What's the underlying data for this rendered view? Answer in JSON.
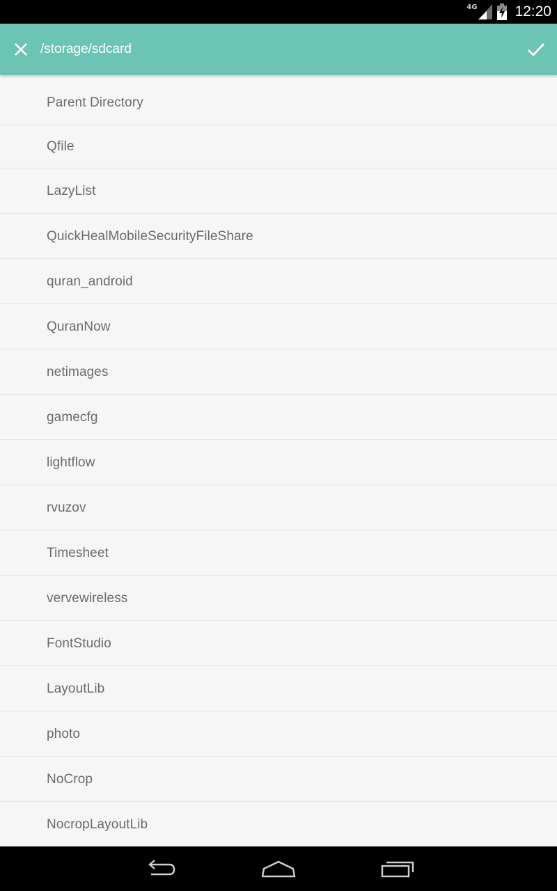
{
  "status_bar": {
    "network_type": "4G",
    "time": "12:20",
    "icons": [
      "signal-icon",
      "battery-icon"
    ]
  },
  "action_bar": {
    "title": "/storage/sdcard",
    "left_icon": "close-icon",
    "right_icon": "checkmark-icon",
    "background_color": "#6cc4b5"
  },
  "file_list": {
    "items": [
      "Parent Directory",
      "Qfile",
      "LazyList",
      "QuickHealMobileSecurityFileShare",
      "quran_android",
      "QuranNow",
      "netimages",
      "gamecfg",
      "lightflow",
      "rvuzov",
      "Timesheet",
      "vervewireless",
      "FontStudio",
      "LayoutLib",
      "photo",
      "NoCrop",
      "NocropLayoutLib"
    ]
  },
  "nav_bar": {
    "icons": [
      "back-icon",
      "home-icon",
      "recent-apps-icon"
    ]
  }
}
